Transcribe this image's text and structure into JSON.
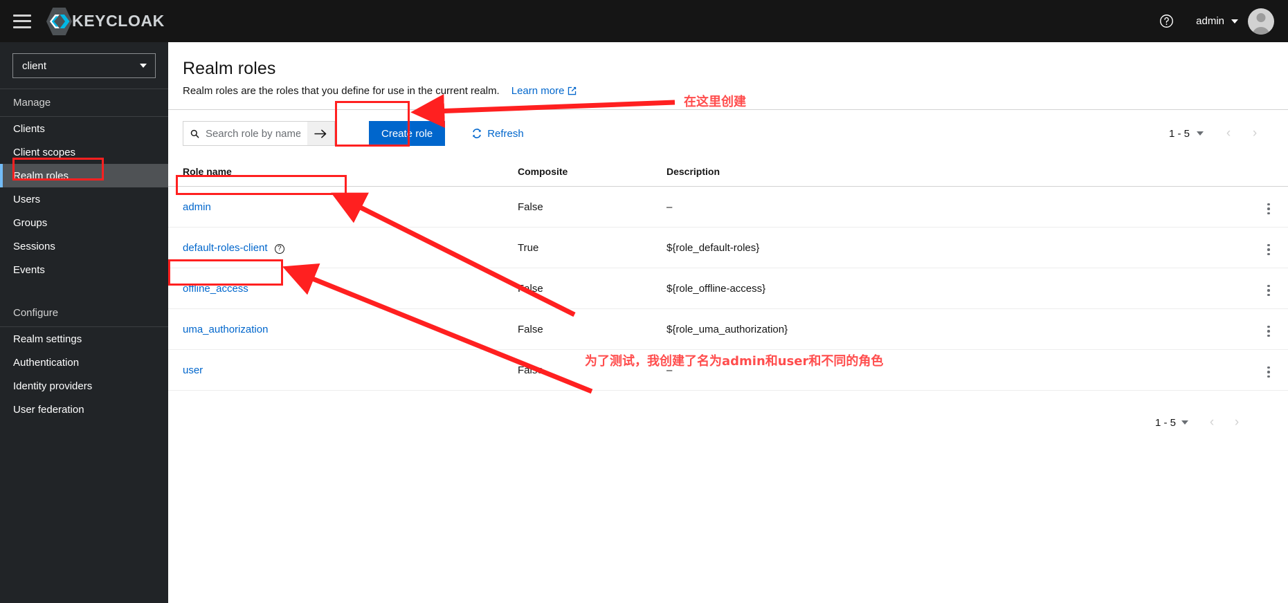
{
  "masthead": {
    "menu_icon": "hamburger-icon",
    "brand_text": "KEYCLOAK",
    "help_icon": "help-circle-icon",
    "user_name": "admin",
    "avatar_icon": "user-avatar-icon"
  },
  "sidebar": {
    "realm_selector": {
      "value": "client"
    },
    "sections": [
      {
        "title": "Manage",
        "items": [
          {
            "label": "Clients",
            "active": false
          },
          {
            "label": "Client scopes",
            "active": false
          },
          {
            "label": "Realm roles",
            "active": true
          },
          {
            "label": "Users",
            "active": false
          },
          {
            "label": "Groups",
            "active": false
          },
          {
            "label": "Sessions",
            "active": false
          },
          {
            "label": "Events",
            "active": false
          }
        ]
      },
      {
        "title": "Configure",
        "items": [
          {
            "label": "Realm settings",
            "active": false
          },
          {
            "label": "Authentication",
            "active": false
          },
          {
            "label": "Identity providers",
            "active": false
          },
          {
            "label": "User federation",
            "active": false
          }
        ]
      }
    ]
  },
  "page": {
    "title": "Realm roles",
    "description": "Realm roles are the roles that you define for use in the current realm.",
    "learn_more": "Learn more",
    "learn_more_icon": "external-link-icon"
  },
  "toolbar": {
    "search_placeholder": "Search role by name",
    "search_value": "",
    "search_icon": "search-icon",
    "search_submit_icon": "arrow-right-icon",
    "create_label": "Create role",
    "refresh_label": "Refresh",
    "refresh_icon": "refresh-icon"
  },
  "pagination_top": {
    "range": "1 - 5",
    "dropdown_icon": "chevron-down-icon",
    "prev_icon": "chevron-left-icon",
    "next_icon": "chevron-right-icon"
  },
  "pagination_bottom": {
    "range": "1 - 5",
    "dropdown_icon": "chevron-down-icon",
    "prev_icon": "chevron-left-icon",
    "next_icon": "chevron-right-icon"
  },
  "table": {
    "columns": [
      "Role name",
      "Composite",
      "Description"
    ],
    "rows": [
      {
        "name": "admin",
        "help": false,
        "composite": "False",
        "description": "–",
        "kebab": "kebab-menu-icon"
      },
      {
        "name": "default-roles-client",
        "help": true,
        "composite": "True",
        "description": "${role_default-roles}",
        "kebab": "kebab-menu-icon"
      },
      {
        "name": "offline_access",
        "help": false,
        "composite": "False",
        "description": "${role_offline-access}",
        "kebab": "kebab-menu-icon"
      },
      {
        "name": "uma_authorization",
        "help": false,
        "composite": "False",
        "description": "${role_uma_authorization}",
        "kebab": "kebab-menu-icon"
      },
      {
        "name": "user",
        "help": false,
        "composite": "False",
        "description": "–",
        "kebab": "kebab-menu-icon"
      }
    ]
  },
  "annotations": {
    "create_here": "在这里创建",
    "roles_note": "为了测试，我创建了名为admin和user和不同的角色",
    "highlight_color": "#ff2020",
    "text_color": "#fc5353"
  }
}
